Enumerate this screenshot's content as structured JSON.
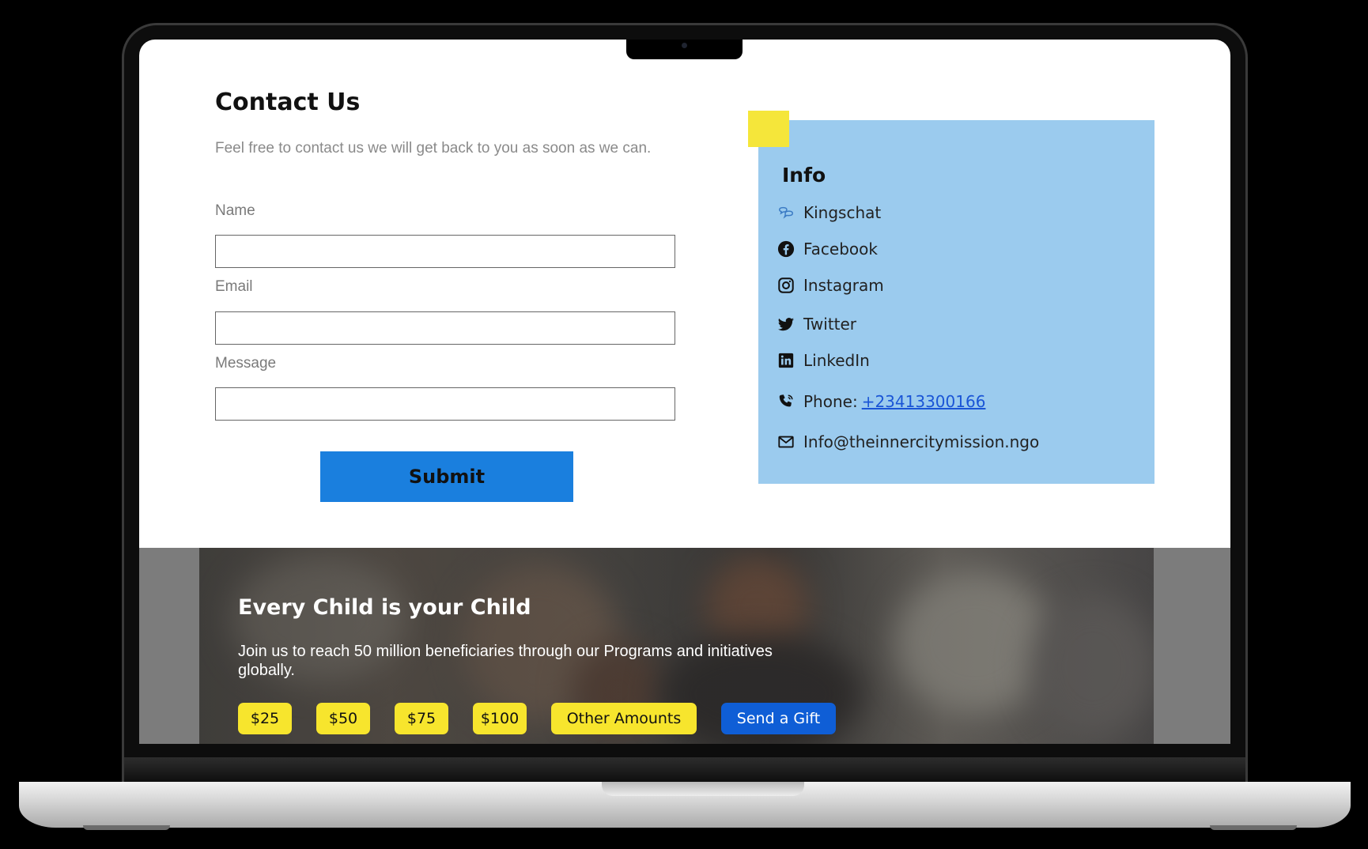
{
  "contact": {
    "title": "Contact Us",
    "description": "Feel free to contact us we will get back to you as soon as we can.",
    "fields": [
      {
        "label": "Name",
        "value": "",
        "placeholder": ""
      },
      {
        "label": "Email",
        "value": "",
        "placeholder": ""
      },
      {
        "label": "Message",
        "value": "",
        "placeholder": ""
      }
    ],
    "submit_label": "Submit"
  },
  "info": {
    "title": "Info",
    "items": [
      {
        "icon": "kingschat-icon",
        "label": "Kingschat"
      },
      {
        "icon": "facebook-icon",
        "label": "Facebook"
      },
      {
        "icon": "instagram-icon",
        "label": "Instagram"
      },
      {
        "icon": "twitter-icon",
        "label": "Twitter"
      },
      {
        "icon": "linkedin-icon",
        "label": "LinkedIn"
      }
    ],
    "phone": {
      "icon": "phone-icon",
      "label": "Phone:",
      "number": "+23413300166"
    },
    "email": {
      "icon": "mail-icon",
      "address": "Info@theinnercitymission.ngo"
    }
  },
  "banner": {
    "title": "Every Child is your Child",
    "description": "Join us to reach 50 million beneficiaries through our Programs and initiatives globally.",
    "amounts": [
      "$25",
      "$50",
      "$75",
      "$100",
      "Other Amounts"
    ],
    "gift_label": "Send a Gift"
  },
  "colors": {
    "submit": "#1a7fde",
    "info_panel": "#9bcbee",
    "accent_yellow": "#f5e63a",
    "amount_button": "#f7e52d",
    "gift_button": "#0f5ed6",
    "phone_link": "#1a55d6"
  }
}
